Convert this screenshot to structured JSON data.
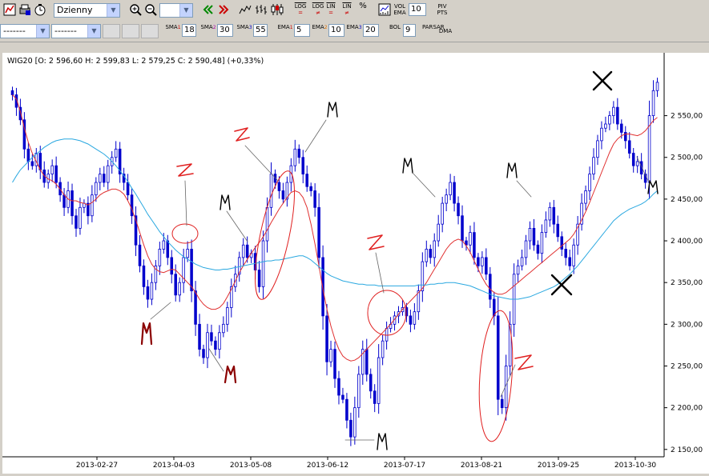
{
  "toolbar": {
    "period_select": "Dzienny",
    "zoom_field": "",
    "log_label": "LOG",
    "lin_label": "LIN",
    "percent_label": "%",
    "vol_label": "VOL",
    "ema_label": "EMA",
    "vol_ema_value": "10",
    "piv_label": "PIV",
    "pts_label": "PTS"
  },
  "toolbar2": {
    "combo1": "-------",
    "combo2": "-------",
    "sma_label": "SMA",
    "ema_label": "EMA",
    "bol_label": "BOL",
    "par_label": "PAR",
    "sar_label": "SAR",
    "dma_label": "DMA",
    "sma": [
      {
        "idx": "1",
        "value": "18"
      },
      {
        "idx": "2",
        "value": "30"
      },
      {
        "idx": "3",
        "value": "55"
      }
    ],
    "ema": [
      {
        "idx": "1",
        "value": "5"
      },
      {
        "idx": "2",
        "value": "10"
      },
      {
        "idx": "3",
        "value": "20"
      }
    ],
    "bol_value": "9"
  },
  "chart_data": {
    "type": "candlestick",
    "title": "WIG20 [O: 2 596,60  H: 2 599,83  L: 2 579,25  C: 2 590,48] (+0,33%)",
    "ylim": [
      2145,
      2610
    ],
    "y_ticks": [
      "2 550,00",
      "2 500,00",
      "2 450,00",
      "2 400,00",
      "2 350,00",
      "2 300,00",
      "2 250,00",
      "2 200,00",
      "2 150,00"
    ],
    "y_tick_values": [
      2550,
      2500,
      2450,
      2400,
      2350,
      2300,
      2250,
      2200,
      2150
    ],
    "x_ticks": [
      "2013-02-27",
      "2013-04-03",
      "2013-05-08",
      "2013-06-12",
      "2013-07-17",
      "2013-08-21",
      "2013-09-25",
      "2013-10-30"
    ],
    "closes": [
      2575,
      2560,
      2545,
      2510,
      2495,
      2490,
      2505,
      2485,
      2470,
      2480,
      2490,
      2470,
      2455,
      2440,
      2460,
      2430,
      2415,
      2440,
      2445,
      2430,
      2455,
      2470,
      2480,
      2470,
      2490,
      2500,
      2510,
      2480,
      2470,
      2455,
      2430,
      2395,
      2370,
      2345,
      2330,
      2350,
      2370,
      2390,
      2400,
      2380,
      2360,
      2335,
      2350,
      2380,
      2390,
      2340,
      2300,
      2270,
      2260,
      2290,
      2280,
      2270,
      2290,
      2300,
      2320,
      2345,
      2360,
      2380,
      2395,
      2380,
      2385,
      2365,
      2345,
      2400,
      2440,
      2480,
      2470,
      2460,
      2450,
      2470,
      2490,
      2510,
      2500,
      2480,
      2465,
      2460,
      2440,
      2380,
      2310,
      2255,
      2270,
      2235,
      2215,
      2210,
      2185,
      2165,
      2200,
      2240,
      2270,
      2240,
      2220,
      2205,
      2260,
      2280,
      2295,
      2300,
      2310,
      2315,
      2320,
      2310,
      2300,
      2315,
      2340,
      2375,
      2390,
      2380,
      2400,
      2420,
      2445,
      2455,
      2470,
      2445,
      2430,
      2400,
      2395,
      2410,
      2380,
      2370,
      2380,
      2360,
      2330,
      2310,
      2210,
      2200,
      2250,
      2300,
      2360,
      2370,
      2380,
      2400,
      2415,
      2395,
      2385,
      2410,
      2425,
      2440,
      2420,
      2405,
      2390,
      2380,
      2370,
      2395,
      2420,
      2445,
      2460,
      2480,
      2500,
      2520,
      2535,
      2540,
      2550,
      2560,
      2540,
      2530,
      2520,
      2505,
      2490,
      2495,
      2480,
      2470,
      2550,
      2580,
      2590
    ],
    "series": [
      {
        "values": [
          2575,
          2570,
          2555,
          2535,
          2518,
          2505,
          2495,
          2485,
          2478,
          2474,
          2472,
          2468,
          2462,
          2455,
          2450,
          2448,
          2448,
          2446,
          2445,
          2443,
          2446,
          2450,
          2455,
          2458,
          2460,
          2462,
          2462,
          2460,
          2456,
          2448,
          2438,
          2425,
          2410,
          2395,
          2382,
          2372,
          2366,
          2363,
          2362,
          2364,
          2366,
          2365,
          2360,
          2355,
          2350,
          2345,
          2338,
          2330,
          2324,
          2320,
          2318,
          2318,
          2320,
          2325,
          2333,
          2342,
          2352,
          2362,
          2370,
          2378,
          2385,
          2392,
          2398,
          2405,
          2413,
          2422,
          2430,
          2438,
          2445,
          2452,
          2458,
          2460,
          2458,
          2452,
          2440,
          2420,
          2396,
          2370,
          2342,
          2318,
          2298,
          2282,
          2270,
          2262,
          2258,
          2256,
          2257,
          2260,
          2265,
          2270,
          2275,
          2280,
          2285,
          2290,
          2295,
          2300,
          2306,
          2312,
          2318,
          2323,
          2328,
          2333,
          2338,
          2343,
          2350,
          2358,
          2366,
          2374,
          2382,
          2390,
          2396,
          2400,
          2402,
          2400,
          2394,
          2386,
          2376,
          2366,
          2356,
          2348,
          2342,
          2338,
          2336,
          2336,
          2338,
          2342,
          2346,
          2350,
          2354,
          2358,
          2362,
          2366,
          2370,
          2374,
          2378,
          2382,
          2386,
          2390,
          2394,
          2398,
          2402,
          2408,
          2416,
          2425,
          2435,
          2446,
          2458,
          2470,
          2482,
          2494,
          2506,
          2516,
          2522,
          2526,
          2528,
          2528,
          2527,
          2526,
          2528,
          2532,
          2538,
          2544,
          2548
        ]
      },
      {
        "values": [
          2470,
          2478,
          2485,
          2490,
          2495,
          2500,
          2504,
          2508,
          2512,
          2515,
          2518,
          2520,
          2521,
          2522,
          2522,
          2522,
          2521,
          2520,
          2518,
          2516,
          2513,
          2510,
          2507,
          2504,
          2500,
          2495,
          2490,
          2484,
          2478,
          2471,
          2463,
          2456,
          2448,
          2440,
          2432,
          2425,
          2418,
          2411,
          2405,
          2399,
          2394,
          2389,
          2385,
          2381,
          2378,
          2375,
          2372,
          2370,
          2368,
          2367,
          2366,
          2365,
          2365,
          2366,
          2366,
          2367,
          2368,
          2369,
          2370,
          2371,
          2372,
          2373,
          2374,
          2375,
          2376,
          2376,
          2377,
          2377,
          2378,
          2379,
          2380,
          2381,
          2382,
          2382,
          2380,
          2377,
          2373,
          2369,
          2365,
          2361,
          2358,
          2356,
          2354,
          2352,
          2351,
          2350,
          2349,
          2348,
          2348,
          2347,
          2347,
          2347,
          2346,
          2346,
          2346,
          2346,
          2346,
          2346,
          2346,
          2346,
          2346,
          2346,
          2347,
          2347,
          2347,
          2348,
          2348,
          2349,
          2349,
          2350,
          2350,
          2350,
          2349,
          2348,
          2347,
          2346,
          2344,
          2342,
          2340,
          2338,
          2336,
          2334,
          2333,
          2332,
          2331,
          2330,
          2330,
          2330,
          2331,
          2332,
          2333,
          2335,
          2337,
          2339,
          2341,
          2343,
          2345,
          2348,
          2352,
          2356,
          2360,
          2365,
          2370,
          2376,
          2382,
          2388,
          2394,
          2400,
          2406,
          2412,
          2418,
          2424,
          2428,
          2432,
          2435,
          2438,
          2440,
          2442,
          2444,
          2447,
          2451,
          2456,
          2460
        ]
      }
    ],
    "annotations": [
      "M",
      "M",
      "M",
      "M",
      "M",
      "M",
      "M",
      "M",
      "Z",
      "Z",
      "Z",
      "Z",
      "X",
      "X"
    ]
  }
}
